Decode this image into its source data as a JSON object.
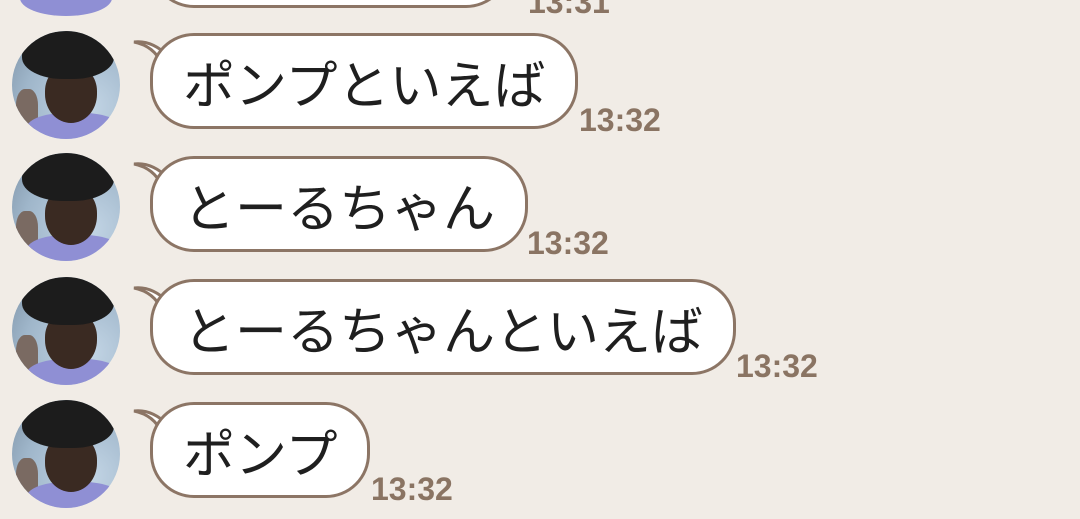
{
  "chat": {
    "previous_message": {
      "time": "13:31"
    },
    "messages": [
      {
        "text": "ポンプといえば",
        "time": "13:32"
      },
      {
        "text": "とーるちゃん",
        "time": "13:32"
      },
      {
        "text": "とーるちゃんといえば",
        "time": "13:32"
      },
      {
        "text": "ポンプ",
        "time": "13:32"
      }
    ]
  },
  "colors": {
    "background": "#f1ece6",
    "bubble_border": "#8c7565",
    "timestamp": "#8a7463"
  },
  "icons": {
    "avatar": "user-avatar-icon"
  }
}
